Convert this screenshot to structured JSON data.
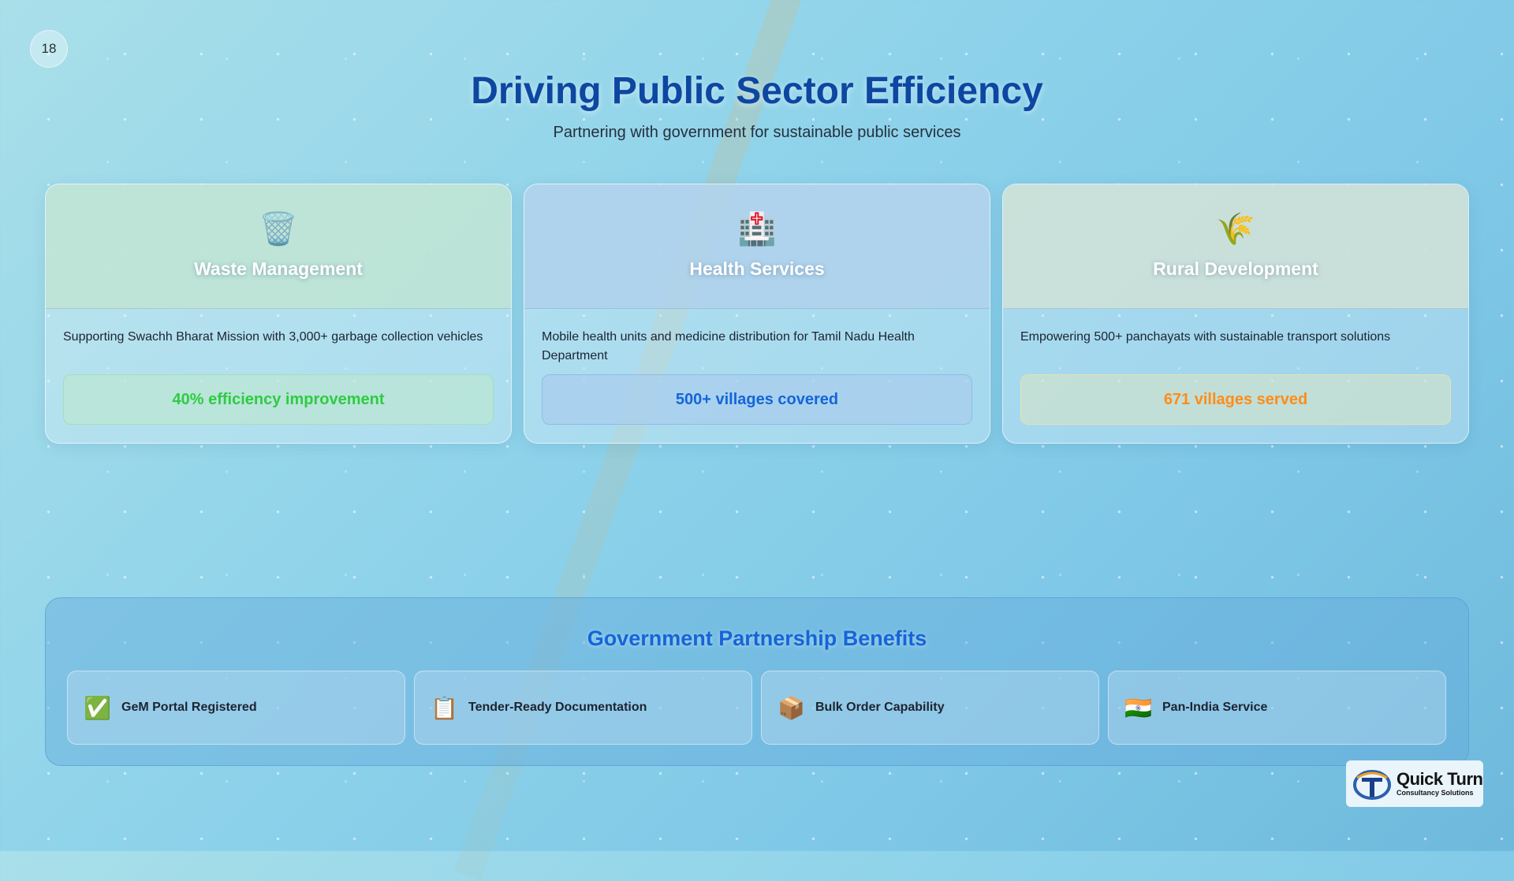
{
  "page": {
    "number": "18",
    "title": "Driving Public Sector Efficiency",
    "subtitle": "Partnering with government for sustainable public services"
  },
  "cards": [
    {
      "icon": "wastebasket-icon",
      "glyph": "🗑️",
      "title": "Waste Management",
      "description": "Supporting Swachh Bharat Mission with 3,000+ garbage collection vehicles",
      "stat": "40% efficiency improvement",
      "stat_color": "#2ecc40"
    },
    {
      "icon": "hospital-icon",
      "glyph": "🏥",
      "title": "Health Services",
      "description": "Mobile health units and medicine distribution for Tamil Nadu Health Department",
      "stat": "500+ villages covered",
      "stat_color": "#1565d8"
    },
    {
      "icon": "rice-sheaf-icon",
      "glyph": "🌾",
      "title": "Rural Development",
      "description": "Empowering 500+ panchayats with sustainable transport solutions",
      "stat": "671 villages served",
      "stat_color": "#ff8c1a"
    }
  ],
  "benefits": {
    "title": "Government Partnership Benefits",
    "items": [
      {
        "icon": "check-mark-icon",
        "glyph": "✅",
        "label": "GeM Portal Registered"
      },
      {
        "icon": "clipboard-icon",
        "glyph": "📋",
        "label": "Tender-Ready Documentation"
      },
      {
        "icon": "package-icon",
        "glyph": "📦",
        "label": "Bulk Order Capability"
      },
      {
        "icon": "india-flag-icon",
        "glyph": "🇮🇳",
        "label": "Pan-India Service"
      }
    ]
  },
  "logo": {
    "name": "Quick Turn",
    "tagline": "Consultancy Solutions"
  },
  "colors": {
    "title": "#0d47a1",
    "accent_blue": "#1565d8",
    "accent_green": "#2ecc40",
    "accent_orange": "#ff8c1a"
  }
}
